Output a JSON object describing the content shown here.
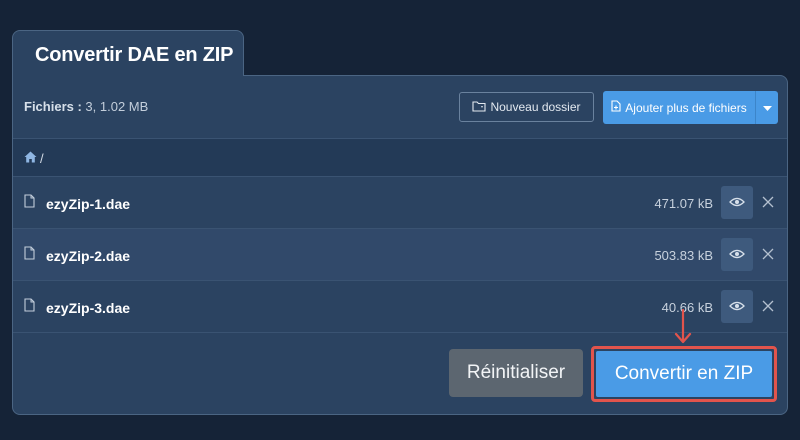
{
  "tab": {
    "title": "Convertir DAE en ZIP"
  },
  "toolbar": {
    "files_label": "Fichiers :",
    "files_value": "3, 1.02 MB",
    "new_folder_label": "Nouveau dossier",
    "add_files_label": "Ajouter plus de fichiers"
  },
  "breadcrumb": {
    "separator": "/"
  },
  "files": [
    {
      "name": "ezyZip-1.dae",
      "size": "471.07 kB"
    },
    {
      "name": "ezyZip-2.dae",
      "size": "503.83 kB"
    },
    {
      "name": "ezyZip-3.dae",
      "size": "40.66 kB"
    }
  ],
  "actions": {
    "reset_label": "Réinitialiser",
    "convert_label": "Convertir en ZIP"
  },
  "colors": {
    "background": "#152337",
    "panel": "#2b4361",
    "accent": "#4a9be6",
    "highlight": "#e2544c"
  },
  "icons": [
    "folder-sync-icon",
    "file-add-icon",
    "caret-down-icon",
    "home-icon",
    "file-icon",
    "eye-icon",
    "close-icon",
    "arrow-down-icon"
  ]
}
